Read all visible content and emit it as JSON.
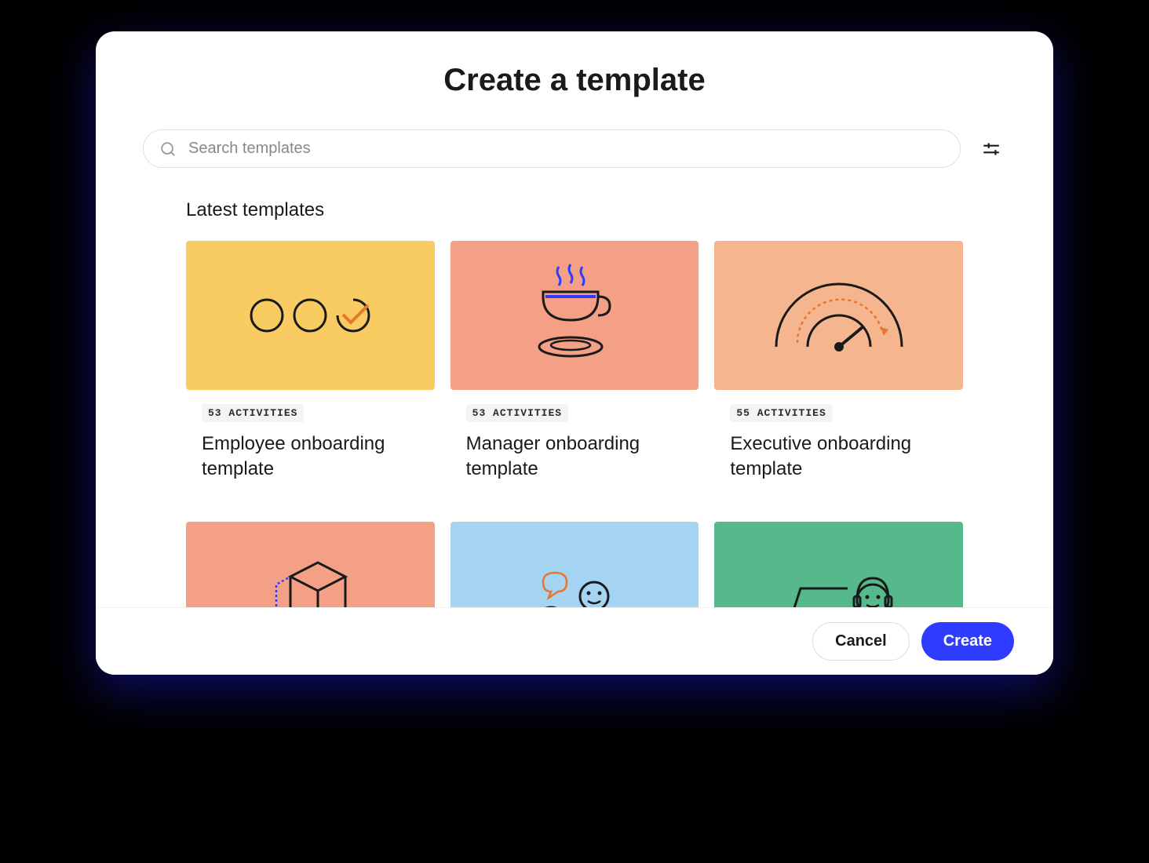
{
  "header": {
    "title": "Create a template"
  },
  "search": {
    "placeholder": "Search templates"
  },
  "section": {
    "heading": "Latest templates"
  },
  "templates": [
    {
      "badge": "53 ACTIVITIES",
      "title": "Employee onboarding template"
    },
    {
      "badge": "53 ACTIVITIES",
      "title": "Manager onboarding template"
    },
    {
      "badge": "55 ACTIVITIES",
      "title": "Executive onboarding template"
    },
    {
      "badge": "",
      "title": ""
    },
    {
      "badge": "",
      "title": ""
    },
    {
      "badge": "",
      "title": ""
    }
  ],
  "footer": {
    "cancel_label": "Cancel",
    "create_label": "Create"
  }
}
